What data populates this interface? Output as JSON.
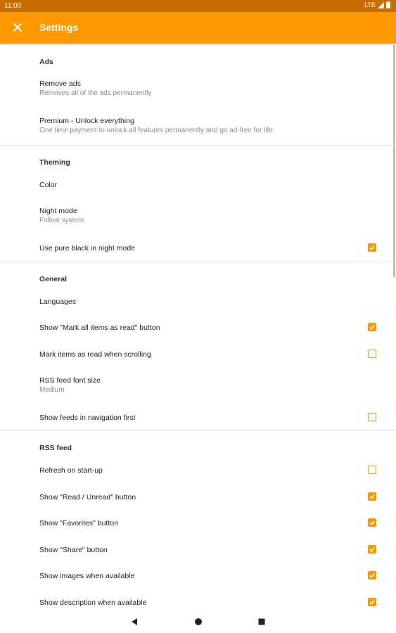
{
  "status": {
    "time": "11:00",
    "network": "LTE"
  },
  "appbar": {
    "title": "Settings",
    "close_icon": "close-icon",
    "color": "#ff9800"
  },
  "sections": {
    "ads": {
      "title": "Ads",
      "remove_ads": {
        "title": "Remove ads",
        "summary": "Removes all of the ads permanently"
      },
      "premium": {
        "title": "Premium - Unlock everything",
        "summary": "One time payment to unlock all features permanently and go ad-free for life"
      }
    },
    "theming": {
      "title": "Theming",
      "color": {
        "title": "Color"
      },
      "night_mode": {
        "title": "Night mode",
        "summary": "Follow system"
      },
      "pure_black": {
        "title": "Use pure black in night mode",
        "checked": true
      }
    },
    "general": {
      "title": "General",
      "languages": {
        "title": "Languages"
      },
      "mark_all_read": {
        "title": "Show \"Mark all items as read\" button",
        "checked": true
      },
      "mark_scrolling": {
        "title": "Mark items as read when scrolling",
        "checked": false
      },
      "font_size": {
        "title": "RSS feed font size",
        "summary": "Medium"
      },
      "feeds_first": {
        "title": "Show feeds in navigation first",
        "checked": false
      }
    },
    "rss": {
      "title": "RSS feed",
      "refresh_startup": {
        "title": "Refresh on start-up",
        "checked": false
      },
      "read_unread": {
        "title": "Show \"Read / Unread\" button",
        "checked": true
      },
      "favorites": {
        "title": "Show \"Favorites\" button",
        "checked": true
      },
      "share": {
        "title": "Show \"Share\" button",
        "checked": true
      },
      "images": {
        "title": "Show images when available",
        "checked": true
      },
      "description": {
        "title": "Show description when available",
        "checked": true
      }
    }
  },
  "navbar": {
    "back": "back-icon",
    "home": "home-icon",
    "recents": "recents-icon"
  }
}
